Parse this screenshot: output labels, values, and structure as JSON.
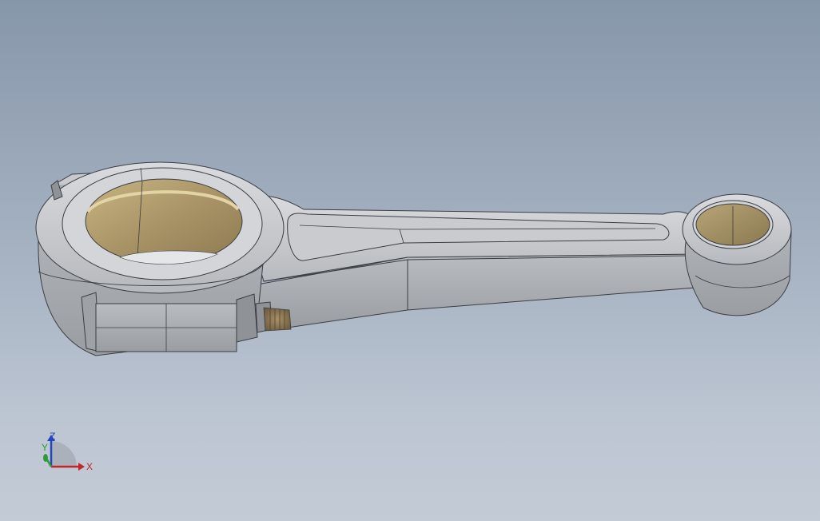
{
  "viewport": {
    "background_top": "#8797aa",
    "background_bottom": "#c3cbd6"
  },
  "model": {
    "part": "connecting-rod",
    "metal_color": "#c4c6c9",
    "bearing_color": "#b49f6c"
  },
  "triad": {
    "x_label": "X",
    "y_label": "Y",
    "z_label": "Z",
    "x_color": "#c0262b",
    "y_color": "#2f9a38",
    "z_color": "#2346b8"
  }
}
